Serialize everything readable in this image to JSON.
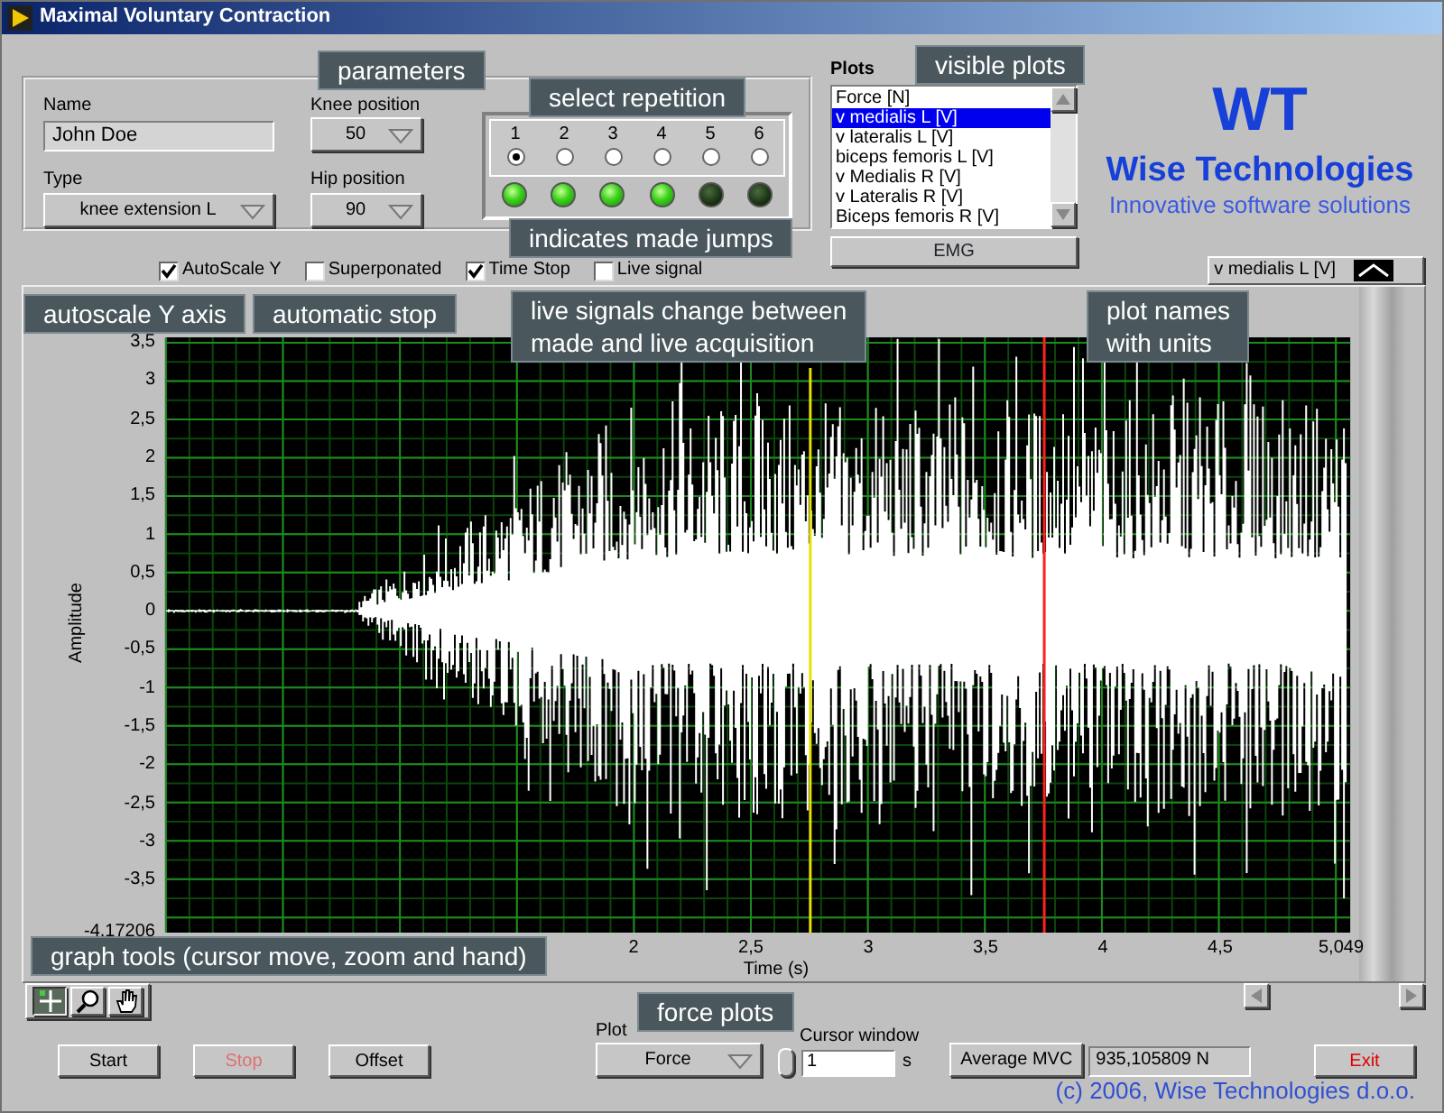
{
  "window": {
    "title": "Maximal Voluntary Contraction"
  },
  "parameters": {
    "name": {
      "label": "Name",
      "value": "John Doe"
    },
    "type": {
      "label": "Type",
      "value": "knee extension L"
    },
    "knee_position": {
      "label": "Knee position",
      "value": "50"
    },
    "hip_position": {
      "label": "Hip position",
      "value": "90"
    }
  },
  "repetitions": [
    {
      "label": "1",
      "selected": true,
      "jump_made": true
    },
    {
      "label": "2",
      "selected": false,
      "jump_made": true
    },
    {
      "label": "3",
      "selected": false,
      "jump_made": true
    },
    {
      "label": "4",
      "selected": false,
      "jump_made": true
    },
    {
      "label": "5",
      "selected": false,
      "jump_made": false
    },
    {
      "label": "6",
      "selected": false,
      "jump_made": false
    }
  ],
  "plots": {
    "label": "Plots",
    "items": [
      {
        "label": "Force [N]",
        "selected": false
      },
      {
        "label": "v  medialis L [V]",
        "selected": true
      },
      {
        "label": "v  lateralis L [V]",
        "selected": false
      },
      {
        "label": "biceps femoris L [V]",
        "selected": false
      },
      {
        "label": "v Medialis R [V]",
        "selected": false
      },
      {
        "label": "v Lateralis R [V]",
        "selected": false
      },
      {
        "label": "Biceps femoris R [V]",
        "selected": false
      }
    ],
    "button": "EMG"
  },
  "logo": {
    "mark": "WT",
    "company": "Wise Technologies",
    "tagline": "Innovative software solutions"
  },
  "options": [
    {
      "label": "AutoScale Y",
      "checked": true
    },
    {
      "label": "Superponated",
      "checked": false
    },
    {
      "label": "Time Stop",
      "checked": true
    },
    {
      "label": "Live signal",
      "checked": false
    }
  ],
  "graph": {
    "legend": "v  medialis L [V]",
    "ylabel": "Amplitude",
    "xlabel": "Time (s)",
    "yticks": [
      "3,5",
      "3",
      "2,5",
      "2",
      "1,5",
      "1",
      "0,5",
      "0",
      "-0,5",
      "-1",
      "-1,5",
      "-2",
      "-2,5",
      "-3",
      "-3,5",
      "-4,17206"
    ],
    "xticks": [
      "2",
      "2,5",
      "3",
      "3,5",
      "4",
      "4,5",
      "5,049"
    ],
    "tools": [
      {
        "kind": "cursor",
        "selected": true
      },
      {
        "kind": "zoom",
        "selected": false
      },
      {
        "kind": "hand",
        "selected": false
      }
    ]
  },
  "controls": {
    "start": "Start",
    "stop": {
      "label": "Stop",
      "disabled": true
    },
    "offset": "Offset",
    "plot": {
      "label": "Plot",
      "value": "Force"
    },
    "cursor_window": {
      "label": "Cursor window",
      "value": "1",
      "unit": "s"
    },
    "average_button": "Average MVC",
    "average_value": "935,105809 N",
    "exit": "Exit"
  },
  "copyright": "(c) 2006, Wise Technologies d.o.o.",
  "annotations": [
    {
      "text": "parameters"
    },
    {
      "text": "select repetition"
    },
    {
      "text": "indicates made jumps"
    },
    {
      "text": "visible plots"
    },
    {
      "text": "autoscale Y axis"
    },
    {
      "text": "automatic stop"
    },
    {
      "text": "live signals change between\nmade and live acquisition"
    },
    {
      "text": "plot names\nwith units"
    },
    {
      "text": "graph tools (cursor move, zoom and hand)"
    },
    {
      "text": "force plots"
    }
  ]
}
